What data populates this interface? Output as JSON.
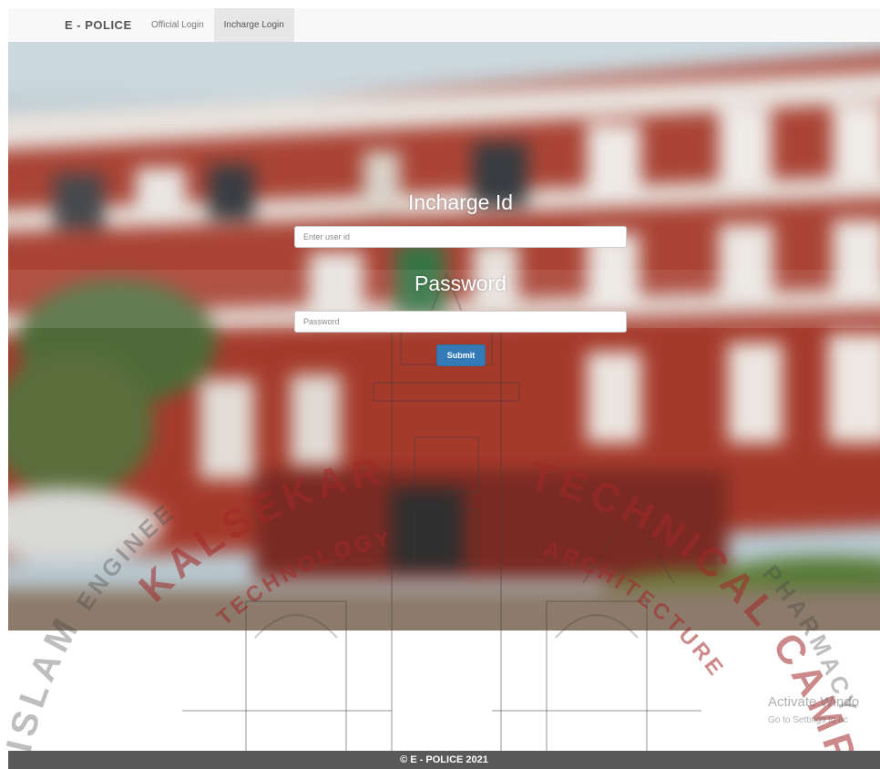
{
  "navbar": {
    "brand": "E - POLICE",
    "links": [
      {
        "label": "Official Login",
        "active": false
      },
      {
        "label": "Incharge Login",
        "active": true
      }
    ]
  },
  "form": {
    "id_label": "Incharge Id",
    "id_placeholder": "Enter user id",
    "password_label": "Password",
    "password_placeholder": "Password",
    "submit_label": "Submit"
  },
  "watermark": {
    "text_left": "ISLAM",
    "text_top": "KALSEKAR",
    "text_arc": "TECHNICAL CAMPUS",
    "text_inner": "TECHNOLOGY",
    "text_inner2": "ARCHITECTURE",
    "text_bottom_left": "ENGINEERING",
    "text_bottom_right": "PHARMACY"
  },
  "os_overlay": {
    "title": "Activate Windo",
    "subtitle": "Go to Settings to ac"
  },
  "footer": {
    "text": "© E - POLICE 2021"
  },
  "colors": {
    "navbar_bg": "#f8f8f8",
    "active_tab_bg": "#e7e7e7",
    "button_primary": "#337ab7",
    "footer_bg": "#595959",
    "brick": "#a83a2c"
  }
}
